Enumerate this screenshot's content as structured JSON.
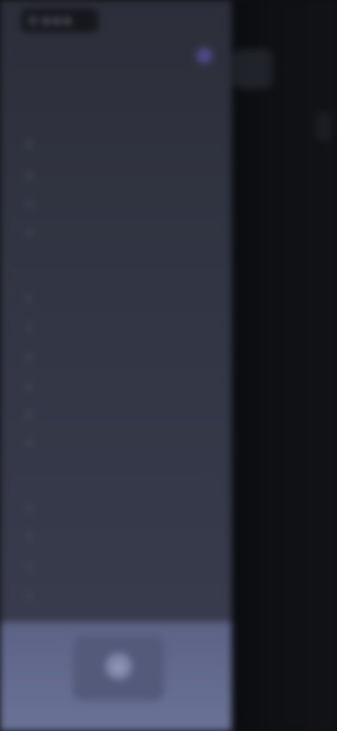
{
  "topbar": {
    "label": "■ ■ ■"
  },
  "server": {
    "title": "",
    "subtitle": ""
  },
  "sections": [
    {
      "label": "",
      "items": [
        "",
        "",
        "",
        ""
      ]
    },
    {
      "label": "",
      "items": [
        "",
        "",
        "",
        "",
        "",
        ""
      ]
    },
    {
      "label": "",
      "items": [
        "",
        "",
        "",
        ""
      ]
    }
  ],
  "colors": {
    "drawer": "#343746",
    "scrim": "#0f1014",
    "bottom_nav": "#6a7296",
    "accent": "#4f4a8c"
  },
  "icons": {
    "home": "home-icon",
    "server": "server-icon",
    "chevron": "chevron-down-icon"
  }
}
